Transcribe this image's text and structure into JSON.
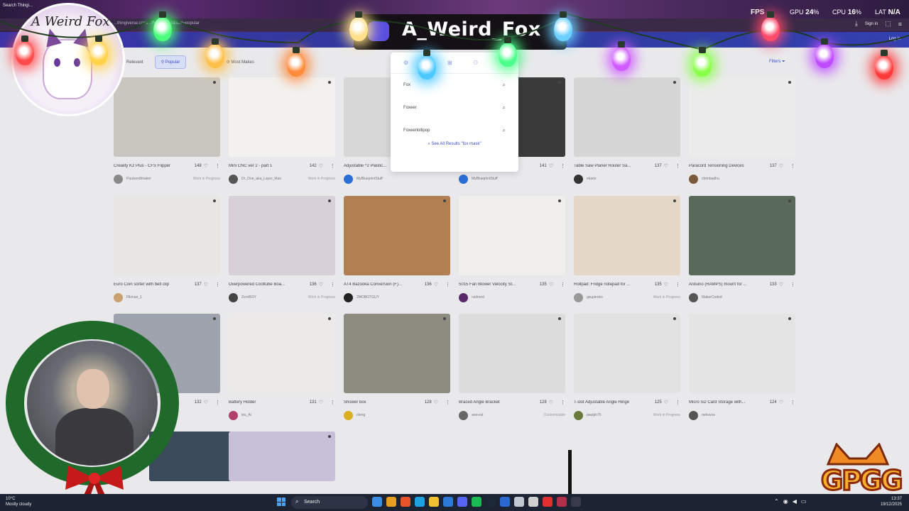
{
  "overlay": {
    "search_tab": "Search Thingi...",
    "url": "...thingiverse.com/...ffs?page=1&sort=popular",
    "channel_name": "A_Weird_Fox",
    "logo_text": "A Weird Fox",
    "stats": {
      "fps_label": "FPS",
      "gpu_label": "GPU",
      "gpu_value": "24",
      "cpu_label": "CPU",
      "cpu_value": "16",
      "lat_label": "LAT",
      "lat_value": "N/A",
      "percent": "%"
    },
    "signin": "Sign in",
    "gpgg": "GPGG"
  },
  "site": {
    "login": "Log in",
    "filters": {
      "relevant": "Relevant",
      "popular": "Popular",
      "most_makes": "Most Makes",
      "filters_btn": "Filters"
    },
    "search_dropdown": {
      "tab_icons": [
        "gear-icon",
        "grid-icon",
        "user-icon"
      ],
      "suggestions": [
        "Fox",
        "Foxeer",
        "Foxeerlollipop"
      ],
      "see_all": "See All Results \"fox mask\""
    },
    "cards": [
      {
        "title": "Creality K2 Plus - CFS Flipper",
        "likes": "148",
        "author": "Paulsen8maker",
        "status": "Work in Progress",
        "thumb": "#c9c6c0",
        "avatar": "#8a8a8a"
      },
      {
        "title": "Mini CNC ver 2 - part 1",
        "likes": "142",
        "author": "Dr_One_aka_Layer_Man",
        "status": "Work in Progress",
        "thumb": "#f2f1ef",
        "avatar": "#555"
      },
      {
        "title": "Adjustable ^2 Plastic...",
        "likes": "",
        "author": "MyBlueprintStuff",
        "status": "",
        "thumb": "#d7d7d7",
        "avatar": "#2b6fd6"
      },
      {
        "title": "",
        "likes": "141",
        "author": "MyBlueprintStuff",
        "status": "",
        "thumb": "#3a3a3a",
        "avatar": "#2b6fd6"
      },
      {
        "title": "Table Saw Planer Router Sa...",
        "likes": "137",
        "author": "ekartz",
        "status": "",
        "thumb": "#d6d6d6",
        "avatar": "#333"
      },
      {
        "title": "Paracord Tensioning Devices",
        "likes": "137",
        "author": "ctmnbadhu",
        "status": "",
        "thumb": "#ececec",
        "avatar": "#7a5a3a"
      },
      {
        "title": "Euro Coin sorter with belt clip",
        "likes": "137",
        "author": "Flkman_1",
        "status": "",
        "thumb": "#e8e6e2",
        "avatar": "#c9a070"
      },
      {
        "title": "Overpowered Cooltube Boa...",
        "likes": "136",
        "author": "ZeroBOY",
        "status": "Work in Progress",
        "thumb": "#d8d0d8",
        "avatar": "#444"
      },
      {
        "title": "AT4 Bazooka Conversion (F)...",
        "likes": "136",
        "author": "2MOBOTGUY",
        "status": "",
        "thumb": "#b08050",
        "avatar": "#222"
      },
      {
        "title": "5015 Fan Blower Velocity St...",
        "likes": "135",
        "author": "nzdnerd",
        "status": "",
        "thumb": "#f0efed",
        "avatar": "#5a2a6a"
      },
      {
        "title": "Rollpad: Fridge notepad for ...",
        "likes": "135",
        "author": "gsupienko",
        "status": "Work in Progress",
        "thumb": "#e6d8c8",
        "avatar": "#999"
      },
      {
        "title": "Arduino (RAMPS) mount for ...",
        "likes": "133",
        "author": "MakerCoded",
        "status": "",
        "thumb": "#5a6a5a",
        "avatar": "#555"
      },
      {
        "title": "",
        "likes": "132",
        "author": "",
        "status": "",
        "thumb": "#9fa3ad",
        "avatar": "#999"
      },
      {
        "title": "Battery Holder",
        "likes": "131",
        "author": "leu_Ai",
        "status": "",
        "thumb": "#ebeae8",
        "avatar": "#b0406a"
      },
      {
        "title": "Shower box",
        "likes": "128",
        "author": "cbmg",
        "status": "",
        "thumb": "#8c8d80",
        "avatar": "#d8b020"
      },
      {
        "title": "Braced Angle Bracket",
        "likes": "128",
        "author": "anovod",
        "status": "Customizable",
        "thumb": "#dcdcdc",
        "avatar": "#666"
      },
      {
        "title": "T-slot Adjustable Angle Hinge",
        "likes": "125",
        "author": "paulph75",
        "status": "Work in Progress",
        "thumb": "#e2e2e2",
        "avatar": "#6a7a3a"
      },
      {
        "title": "Micro SD Card Storage with...",
        "likes": "124",
        "author": "nebuvos",
        "status": "",
        "thumb": "#e4e4e4",
        "avatar": "#555"
      },
      {
        "title": "",
        "likes": "",
        "author": "",
        "status": "",
        "thumb": "#3a4a5a",
        "avatar": "#999"
      },
      {
        "title": "",
        "likes": "",
        "author": "",
        "status": "",
        "thumb": "#c8c0d8",
        "avatar": "#999"
      }
    ]
  },
  "taskbar": {
    "weather_temp": "10°C",
    "weather_desc": "Mostly cloudy",
    "search": "Search",
    "time": "13:37",
    "date": "19/12/2025"
  },
  "colors": {
    "accent": "#3b4fd0",
    "nav": "#3340b0"
  }
}
